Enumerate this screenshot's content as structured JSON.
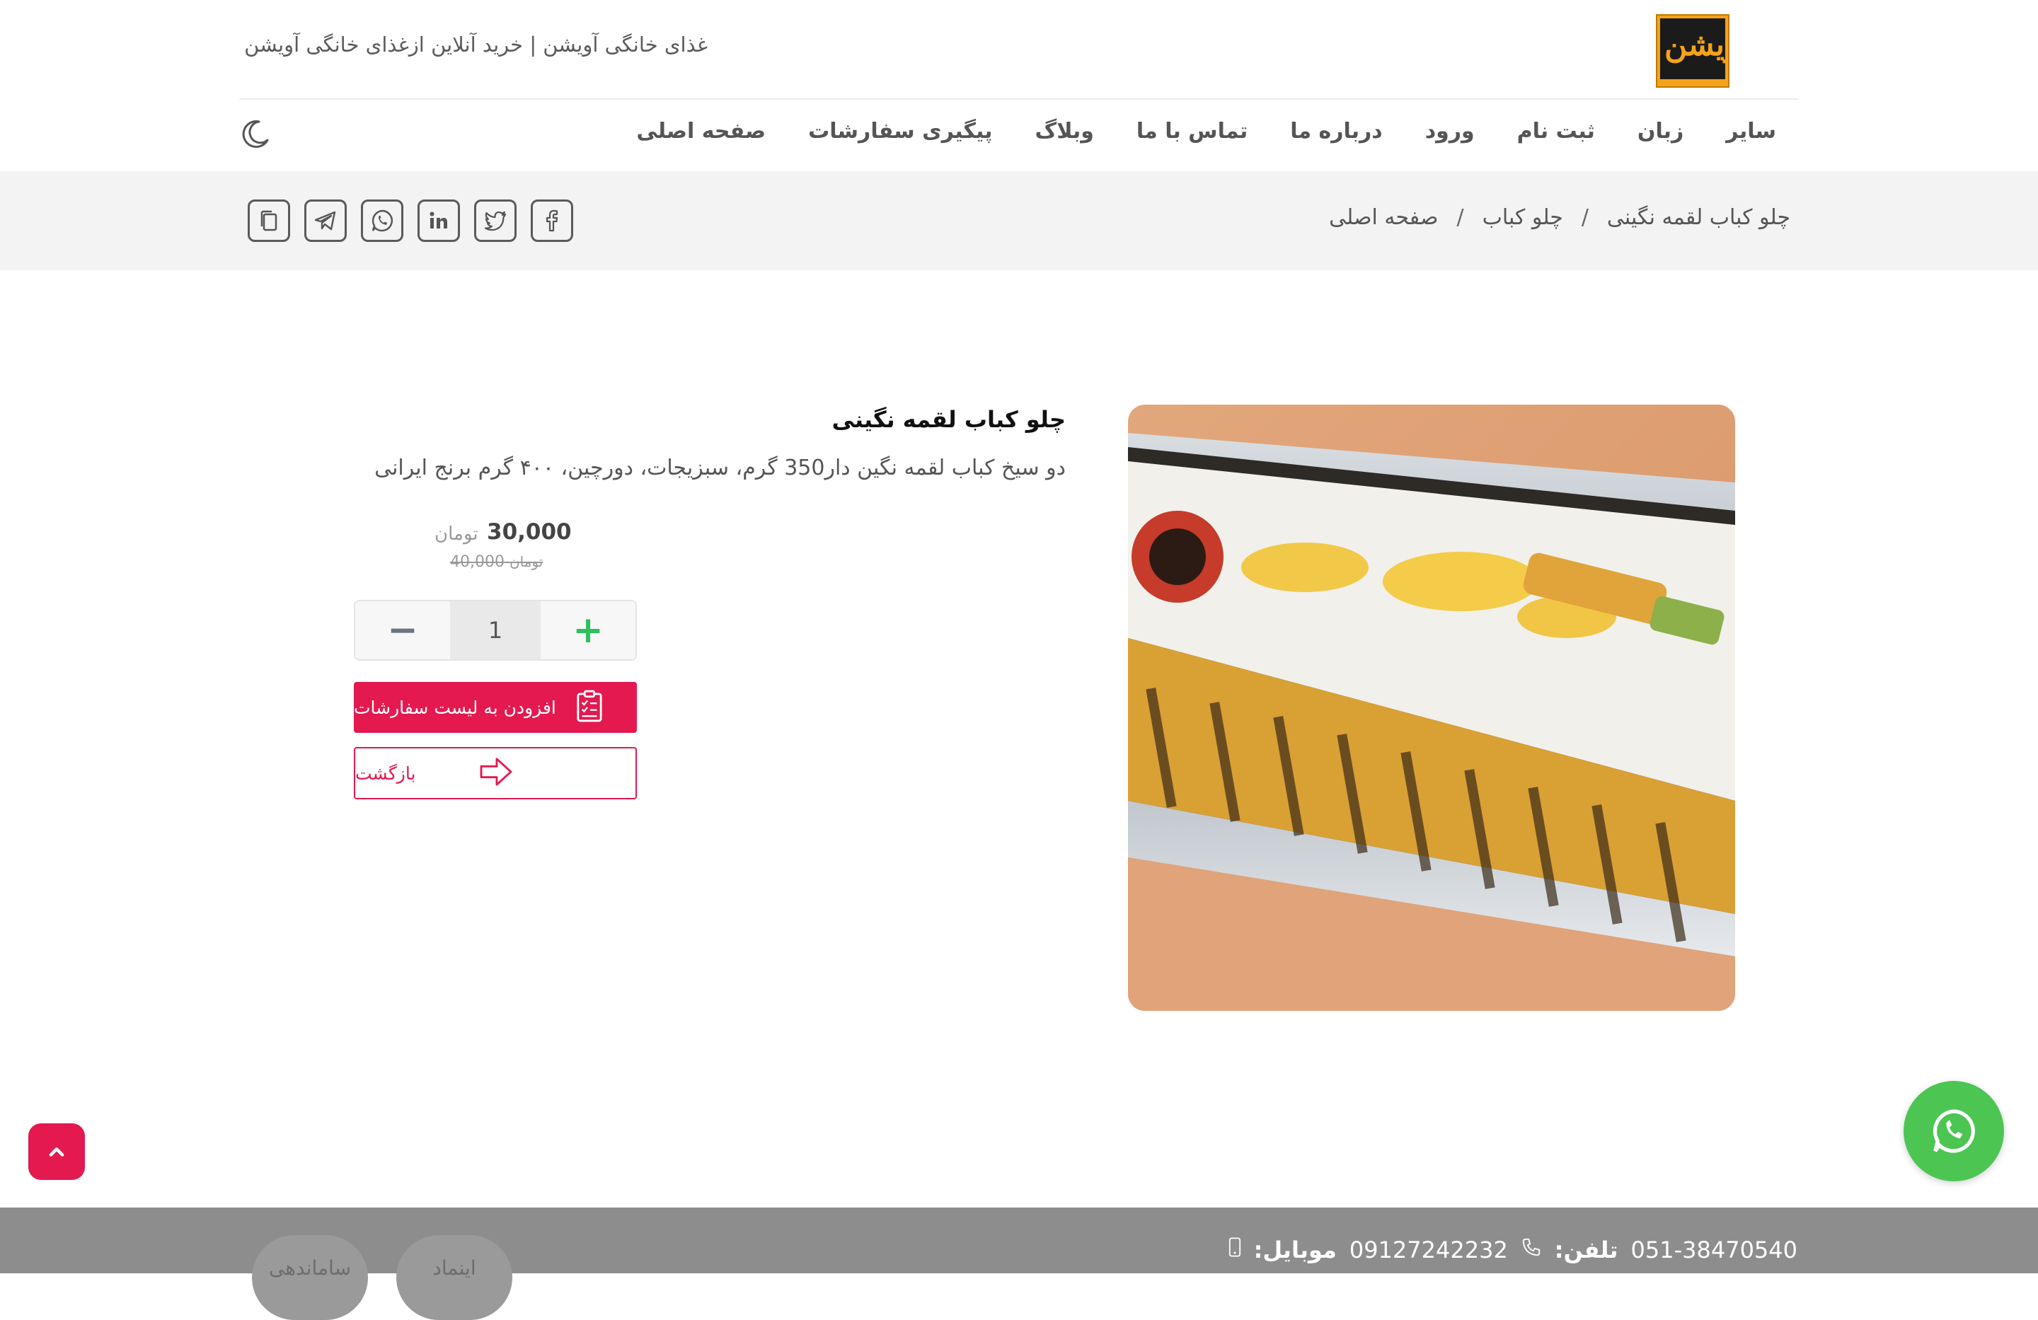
{
  "header": {
    "site_title": "غذای خانگی آویشن | خرید آنلاین ازغذای خانگی آویشن",
    "logo_text": "آویشن",
    "nav": [
      "صفحه اصلی",
      "پیگیری سفارشات",
      "وبلاگ",
      "تماس با ما",
      "درباره ما",
      "ورود",
      "ثبت نام",
      "زبان",
      "سایر"
    ]
  },
  "breadcrumb": {
    "home": "صفحه اصلی",
    "category": "چلو کباب",
    "current": "چلو کباب لقمه نگینی",
    "separator": "/"
  },
  "share_icons": [
    "copy-icon",
    "telegram-icon",
    "whatsapp-icon",
    "linkedin-icon",
    "twitter-icon",
    "facebook-icon"
  ],
  "product": {
    "title": "چلو کباب لقمه نگینی",
    "description": "دو سیخ کباب لقمه نگین دار350 گرم، سبزیجات، دورچین، ۴۰۰ گرم برنج ایرانی",
    "price": "30,000",
    "currency": "تومان",
    "old_price": "40,000",
    "old_currency": "تومان",
    "quantity": "1",
    "minus_label": "−",
    "plus_label": "+",
    "add_to_cart_label": "افزودن به لیست سفارشات",
    "back_label": "بازگشت"
  },
  "footer": {
    "mobile_label": "موبایل:",
    "mobile_value": "09127242232",
    "phone_label": "تلفن:",
    "phone_value": "051-38470540",
    "badge_enamad": "اینماد",
    "badge_samandehi": "ساماندهی"
  },
  "colors": {
    "accent": "#e3194f",
    "whatsapp": "#4cc553",
    "footer_bg": "#8d8d8d",
    "crumb_bg": "#f3f3f3"
  }
}
